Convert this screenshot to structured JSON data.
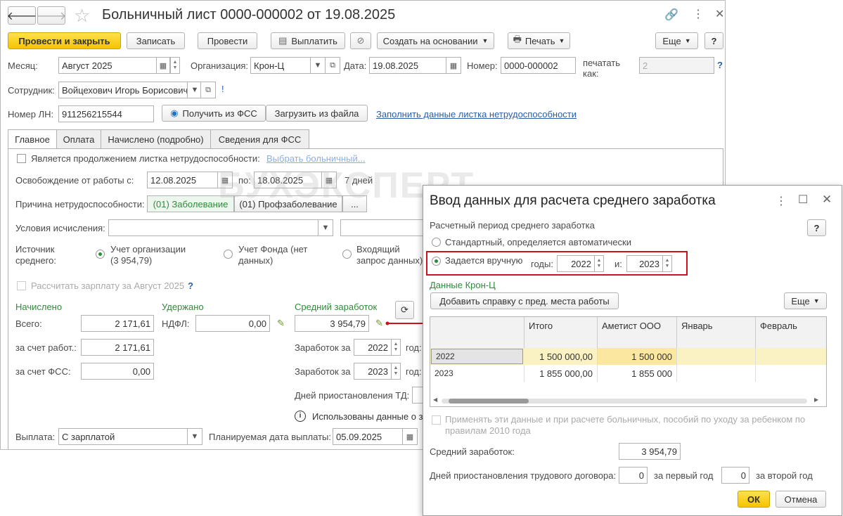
{
  "window": {
    "title": "Больничный лист 0000-000002 от 19.08.2025",
    "toolbar": {
      "post_close": "Провести и закрыть",
      "save": "Записать",
      "post": "Провести",
      "pay": "Выплатить",
      "create_based": "Создать на основании",
      "print": "Печать",
      "more": "Еще",
      "help": "?"
    },
    "fields": {
      "month_label": "Месяц:",
      "month_value": "Август 2025",
      "org_label": "Организация:",
      "org_value": "Крон-Ц",
      "date_label": "Дата:",
      "date_value": "19.08.2025",
      "number_label": "Номер:",
      "number_value": "0000-000002",
      "print_as_label": "печатать как:",
      "print_as_value": "2",
      "employee_label": "Сотрудник:",
      "employee_value": "Войцехович Игорь Борисович",
      "ln_label": "Номер ЛН:",
      "ln_value": "911256215544",
      "get_fss": "Получить из ФСС",
      "load_file": "Загрузить из файла",
      "fill_link": "Заполнить данные листка нетрудоспособности"
    },
    "tabs": [
      "Главное",
      "Оплата",
      "Начислено (подробно)",
      "Сведения для ФСС"
    ],
    "main": {
      "continuation_label": "Является продолжением листка нетрудоспособности:",
      "choose_sick_link": "Выбрать больничный...",
      "release_label": "Освобождение от работы с:",
      "release_from": "12.08.2025",
      "release_to_label": "по:",
      "release_to": "18.08.2025",
      "days": "7 дней",
      "reason_label": "Причина нетрудоспособности:",
      "reason_1": "(01) Заболевание",
      "reason_2": "(01) Профзаболевание",
      "reason_more": "...",
      "conditions_label": "Условия исчисления:",
      "source_label": "Источник среднего:",
      "source_1": "Учет организации (3 954,79)",
      "source_2": "Учет Фонда (нет данных)",
      "source_3": "Входящий запрос данных)",
      "recalc_label": "Рассчитать зарплату за Август 2025",
      "recalc_help": "?",
      "accrued_header": "Начислено",
      "withheld_header": "Удержано",
      "avg_header": "Средний заработок",
      "total_label": "Всего:",
      "total_value": "2 171,61",
      "ndfl_label": "НДФЛ:",
      "ndfl_value": "0,00",
      "avg_value": "3 954,79",
      "employer_label": "за счет работ.:",
      "employer_value": "2 171,61",
      "fss_label": "за счет ФСС:",
      "fss_value": "0,00",
      "earn1_label": "Заработок за",
      "earn1_year": "2022",
      "earn1_suffix": "год:",
      "earn2_label": "Заработок за",
      "earn2_year": "2023",
      "earn2_suffix": "год:",
      "suspend_label": "Дней приостановления ТД:",
      "used_data_note": "Использованы данные о з",
      "payout_label": "Выплата:",
      "payout_value": "С зарплатой",
      "planned_label": "Планируемая дата выплаты:",
      "planned_value": "05.09.2025"
    }
  },
  "watermark": "БУХЭКСПЕРТ",
  "dialog": {
    "title": "Ввод данных для расчета среднего заработка",
    "period_label": "Расчетный период среднего заработка",
    "help": "?",
    "radio_standard": "Стандартный, определяется автоматически",
    "radio_manual": "Задается вручную",
    "years_label": "годы:",
    "year1": "2022",
    "and_label": "и:",
    "year2": "2023",
    "data_header": "Данные Крон-Ц",
    "add_cert": "Добавить справку с пред. места работы",
    "more": "Еще",
    "table": {
      "columns": [
        "",
        "Итого",
        "Аметист ООО",
        "Январь",
        "Февраль"
      ],
      "rows": [
        {
          "year": "2022",
          "total": "1 500 000,00",
          "org": "1 500 000"
        },
        {
          "year": "2023",
          "total": "1 855 000,00",
          "org": "1 855 000"
        }
      ]
    },
    "apply_text": "Применять эти данные и при расчете больничных, пособий по уходу за ребенком по правилам 2010 года",
    "avg_label": "Средний заработок:",
    "avg_value": "3 954,79",
    "suspend_label": "Дней приостановления трудового договора:",
    "first_year_value": "0",
    "first_year_label": "за первый год",
    "second_year_value": "0",
    "second_year_label": "за второй год",
    "ok": "ОК",
    "cancel": "Отмена"
  },
  "colors": {
    "accent_yellow": "#f5c400",
    "highlight_red": "#d0121b",
    "green": "#2e8b3a",
    "link": "#2a5ea8"
  }
}
